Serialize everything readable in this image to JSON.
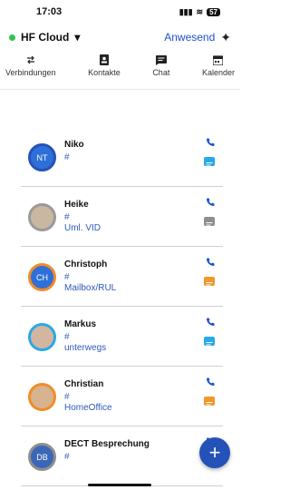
{
  "status": {
    "time": "17:03",
    "battery": "57"
  },
  "header": {
    "account": "HF Cloud",
    "presence": "Anwesend",
    "online_color": "#33c24d"
  },
  "tabs": [
    {
      "label": "Verbindungen",
      "icon": "transfer-icon"
    },
    {
      "label": "Kontakte",
      "icon": "contact-card-icon"
    },
    {
      "label": "Chat",
      "icon": "chat-icon"
    },
    {
      "label": "Kalender",
      "icon": "calendar-icon"
    }
  ],
  "contacts": [
    {
      "name": "Niko",
      "number": "#",
      "status": "",
      "initials": "NT",
      "avatar_bg": "#2e6fd8",
      "ring": "#2552b8",
      "chat_color": "#2aa9e8",
      "photo": false
    },
    {
      "name": "Heike",
      "number": "#",
      "status": "Uml. VID",
      "initials": "",
      "avatar_bg": "#c9b7a2",
      "ring": "#9a9a9a",
      "chat_color": "#8e8e8e",
      "photo": true
    },
    {
      "name": "Christoph",
      "number": "#",
      "status": "Mailbox/RUL",
      "initials": "CH",
      "avatar_bg": "#2e6fd8",
      "ring": "#f08c2a",
      "chat_color": "#f0982a",
      "photo": false
    },
    {
      "name": "Markus",
      "number": "#",
      "status": "unterwegs",
      "initials": "",
      "avatar_bg": "#d3b5a0",
      "ring": "#2aa9e8",
      "chat_color": "#2aa9e8",
      "photo": true
    },
    {
      "name": "Christian",
      "number": "#",
      "status": "HomeOffice",
      "initials": "",
      "avatar_bg": "#d7b38f",
      "ring": "#f08c2a",
      "chat_color": "#f0982a",
      "photo": true
    },
    {
      "name": "DECT Besprechung",
      "number": "#",
      "status": "",
      "initials": "DB",
      "avatar_bg": "#3c67b7",
      "ring": "#8f8f8f",
      "chat_color": "",
      "photo": false
    }
  ],
  "fab_label": "+"
}
